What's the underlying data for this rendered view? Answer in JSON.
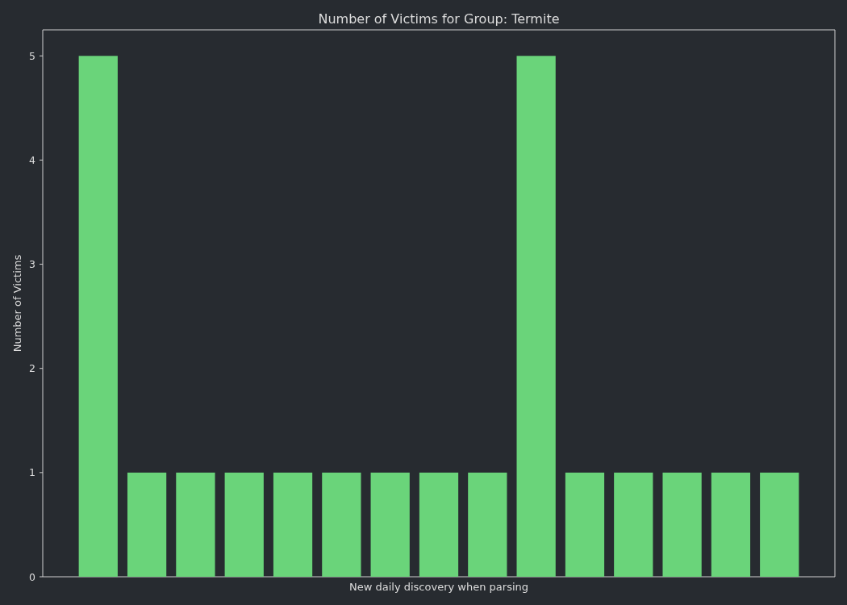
{
  "chart_data": {
    "type": "bar",
    "title": "Number of Victims for Group: Termite",
    "xlabel": "New daily discovery when parsing",
    "ylabel": "Number of Victims",
    "categories": [
      null,
      null,
      null,
      null,
      null,
      null,
      null,
      null,
      null,
      null,
      null,
      null,
      null,
      null,
      null
    ],
    "series": [
      {
        "color": "#6ad47a",
        "values": [
          5,
          1,
          1,
          1,
          1,
          1,
          1,
          1,
          1,
          5,
          1,
          1,
          1,
          1,
          1
        ]
      }
    ],
    "ylim": [
      0,
      5.25
    ],
    "yticks": [
      {
        "value": 0,
        "label": "0"
      },
      {
        "value": 1,
        "label": "1"
      },
      {
        "value": 2,
        "label": "2"
      },
      {
        "value": 3,
        "label": "3"
      },
      {
        "value": 4,
        "label": "4"
      },
      {
        "value": 5,
        "label": "5"
      }
    ]
  }
}
